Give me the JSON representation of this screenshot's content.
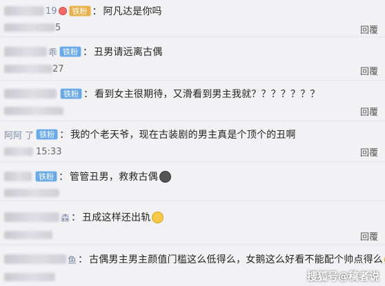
{
  "comments": [
    {
      "name_visible": "19",
      "badge": "铁粉",
      "text": "阿凡达是你吗",
      "time_visible": "5",
      "reply": "回覆"
    },
    {
      "name_visible": "乖",
      "badge": "铁粉",
      "text": "丑男请远离古偶",
      "time_visible": "27",
      "reply": "回覆"
    },
    {
      "name_visible": "",
      "badge": "铁粉",
      "text": "看到女主很期待，又滑看到男主我就？？？？？？？",
      "time_visible": "",
      "reply": "回覆"
    },
    {
      "name_visible": "阿阿   了",
      "badge": "铁粉",
      "text": "我的个老天爷，现在古装剧的男主真是个顶个的丑啊",
      "time_visible": "15:33",
      "reply": "回覆"
    },
    {
      "name_visible": "",
      "badge": "铁粉",
      "text": "管管丑男，救救古偶",
      "time_visible": "",
      "reply": ""
    },
    {
      "name_visible": "森",
      "badge": "",
      "text": "丑成这样还出轨",
      "time_visible": "",
      "reply": "回覆"
    },
    {
      "name_visible": "鱼",
      "badge": "",
      "text": "古偶男主男主颜值门槛这么低得么，女鹅这么好看不能配个帅点得么",
      "time_visible": "",
      "reply": ""
    }
  ],
  "watermark": "搜狐号@稿者说",
  "colors": {
    "badge": "#6aa9e8",
    "badge_gold": "#e8b04a",
    "background": "#f2f2f5"
  }
}
